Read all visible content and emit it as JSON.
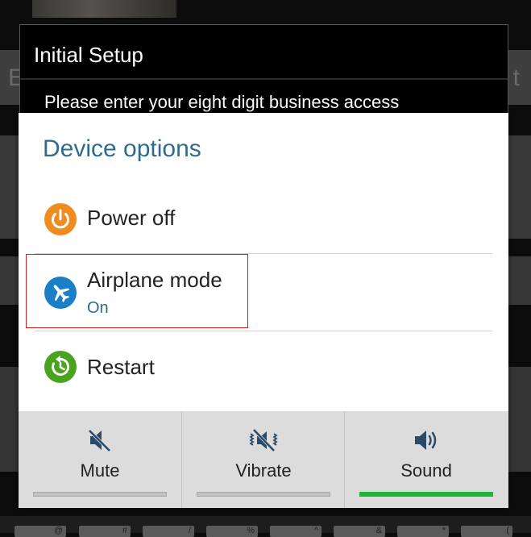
{
  "setup_dialog": {
    "title": "Initial Setup",
    "message": "Please enter your eight digit business access"
  },
  "device_options": {
    "title": "Device options",
    "items": [
      {
        "label": "Power off",
        "icon": "power-icon",
        "color": "#f08c1e"
      },
      {
        "label": "Airplane mode",
        "status": "On",
        "icon": "airplane-icon",
        "color": "#1b7fc8"
      },
      {
        "label": "Restart",
        "icon": "restart-icon",
        "color": "#4aa31f"
      }
    ]
  },
  "sound_modes": {
    "active": "Sound",
    "items": [
      {
        "label": "Mute",
        "icon": "mute-icon"
      },
      {
        "label": "Vibrate",
        "icon": "vibrate-icon"
      },
      {
        "label": "Sound",
        "icon": "speaker-icon"
      }
    ],
    "active_color": "#1fb53a"
  },
  "background": {
    "left_letter": "E",
    "right_letter": "t",
    "keys": [
      "@",
      "#",
      "/",
      "%",
      "^",
      "&",
      "*",
      "("
    ]
  },
  "colors": {
    "accent": "#2f6b8e",
    "highlight_border": "#d02020"
  }
}
